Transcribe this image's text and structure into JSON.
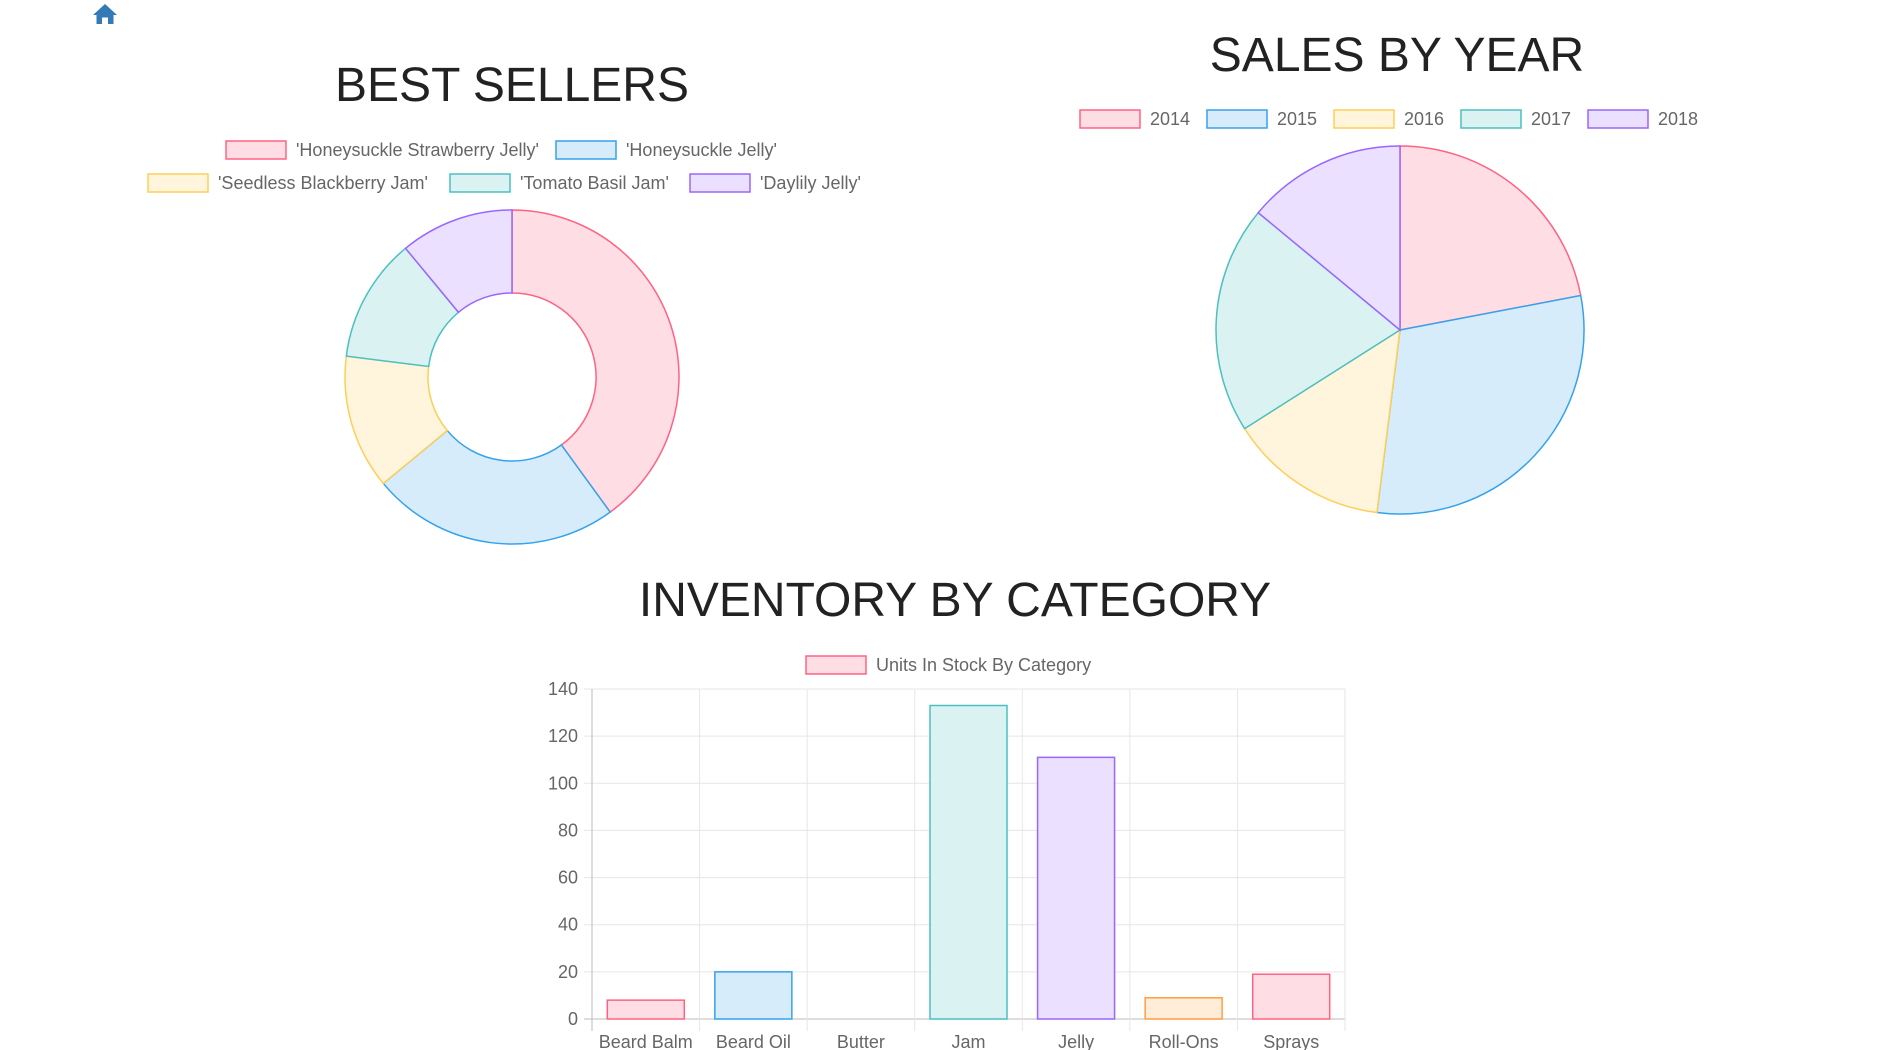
{
  "nav": {
    "home_icon": "home-icon",
    "home_color": "#337ab7"
  },
  "palette": {
    "borders": [
      "#ff6384",
      "#36a2eb",
      "#ffce56",
      "#4bc0c0",
      "#9966ff",
      "#ff9f40"
    ],
    "fills": [
      "#ffdde4",
      "#d7ecfb",
      "#fff5dd",
      "#dbf2f2",
      "#ebe0ff",
      "#ffecd9"
    ]
  },
  "chart_data": [
    {
      "id": "best-sellers",
      "type": "pie",
      "variant": "doughnut",
      "title": "BEST SELLERS",
      "categories": [
        "'Honeysuckle Strawberry Jelly'",
        "'Honeysuckle Jelly'",
        "'Seedless Blackberry Jam'",
        "'Tomato Basil Jam'",
        "'Daylily Jelly'"
      ],
      "values": [
        40,
        24,
        13,
        12,
        11
      ],
      "legend_position": "top"
    },
    {
      "id": "sales-by-year",
      "type": "pie",
      "title": "SALES BY YEAR",
      "categories": [
        "2014",
        "2015",
        "2016",
        "2017",
        "2018"
      ],
      "values": [
        22,
        30,
        14,
        20,
        14
      ],
      "legend_position": "top"
    },
    {
      "id": "inventory-by-category",
      "type": "bar",
      "title": "INVENTORY BY CATEGORY",
      "categories": [
        "Beard Balm",
        "Beard Oil",
        "Butter",
        "Jam",
        "Jelly",
        "Roll-Ons",
        "Sprays"
      ],
      "series": [
        {
          "name": "Units In Stock By Category",
          "values": [
            8,
            20,
            0,
            133,
            111,
            9,
            19
          ]
        }
      ],
      "ylim": [
        0,
        140
      ],
      "yticks": [
        0,
        20,
        40,
        60,
        80,
        100,
        120,
        140
      ],
      "grid": true,
      "legend_position": "top"
    }
  ]
}
